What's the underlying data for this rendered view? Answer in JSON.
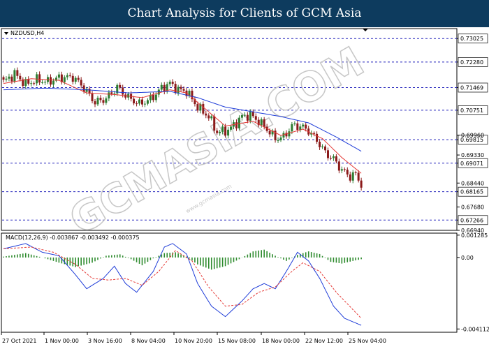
{
  "banner": {
    "title": "Chart Analysis for Clients of GCM Asia"
  },
  "chart_header": {
    "symbol_timeframe": "NZDUSD,H4"
  },
  "watermark": {
    "text": "GCMASIA.COM",
    "sub": "www.gcmasia.com"
  },
  "colors": {
    "banner": "#0d3b5e",
    "bull_candle": "#2e7d32",
    "bear_candle": "#8b1a1a",
    "ma_fast": "#e53935",
    "ma_slow": "#1e3cd8",
    "level_line": "#2222bb",
    "macd_line": "#1e3cd8",
    "signal_line": "#e53935",
    "histogram": "#2e8b2e"
  },
  "chart_data": [
    {
      "type": "candlestick",
      "title": "NZDUSD,H4",
      "ylim": [
        0.6694,
        0.7334
      ],
      "y_axis_labels": [
        "0.73025",
        "0.72280",
        "0.71469",
        "0.70751",
        "0.69815",
        "0.69071",
        "0.68165",
        "0.67266",
        "0.69960",
        "0.69330",
        "0.68440",
        "0.67680",
        "0.66940"
      ],
      "horizontal_levels": [
        0.73025,
        0.7228,
        0.71469,
        0.70751,
        0.69815,
        0.69071,
        0.68165,
        0.67266
      ],
      "plain_ticks": [
        0.6996,
        0.6933,
        0.6844,
        0.6768,
        0.6694
      ],
      "x_tick_labels": [
        "27 Oct 2021",
        "1 Nov 00:00",
        "3 Nov 16:00",
        "8 Nov 04:00",
        "10 Nov 20:00",
        "15 Nov 08:00",
        "18 Nov 00:00",
        "22 Nov 12:00",
        "25 Nov 04:00"
      ],
      "close_anchors": [
        [
          0,
          0.7165
        ],
        [
          4,
          0.719
        ],
        [
          8,
          0.7158
        ],
        [
          12,
          0.7172
        ],
        [
          16,
          0.7165
        ],
        [
          20,
          0.7178
        ],
        [
          25,
          0.718
        ],
        [
          28,
          0.7156
        ],
        [
          33,
          0.71
        ],
        [
          37,
          0.7112
        ],
        [
          41,
          0.7148
        ],
        [
          45,
          0.7115
        ],
        [
          49,
          0.7095
        ],
        [
          53,
          0.711
        ],
        [
          57,
          0.7145
        ],
        [
          60,
          0.716
        ],
        [
          63,
          0.714
        ],
        [
          66,
          0.7135
        ],
        [
          70,
          0.7085
        ],
        [
          74,
          0.7055
        ],
        [
          77,
          0.7005
        ],
        [
          81,
          0.7012
        ],
        [
          84,
          0.7035
        ],
        [
          86,
          0.7055
        ],
        [
          89,
          0.706
        ],
        [
          92,
          0.704
        ],
        [
          95,
          0.7015
        ],
        [
          98,
          0.6985
        ],
        [
          101,
          0.699
        ],
        [
          104,
          0.7025
        ],
        [
          107,
          0.7025
        ],
        [
          110,
          0.701
        ],
        [
          113,
          0.698
        ],
        [
          116,
          0.694
        ],
        [
          119,
          0.692
        ],
        [
          122,
          0.6885
        ],
        [
          125,
          0.6865
        ],
        [
          127,
          0.6872
        ],
        [
          129,
          0.684
        ]
      ],
      "series": [
        {
          "name": "MA fast",
          "anchors": [
            [
              0,
              0.716
            ],
            [
              10,
              0.7175
            ],
            [
              20,
              0.717
            ],
            [
              30,
              0.713
            ],
            [
              40,
              0.7125
            ],
            [
              50,
              0.7115
            ],
            [
              60,
              0.714
            ],
            [
              66,
              0.713
            ],
            [
              72,
              0.7085
            ],
            [
              80,
              0.7025
            ],
            [
              90,
              0.704
            ],
            [
              100,
              0.6995
            ],
            [
              108,
              0.7015
            ],
            [
              115,
              0.6985
            ],
            [
              122,
              0.6925
            ],
            [
              129,
              0.6875
            ]
          ]
        },
        {
          "name": "MA slow",
          "anchors": [
            [
              0,
              0.714
            ],
            [
              15,
              0.7145
            ],
            [
              30,
              0.714
            ],
            [
              45,
              0.713
            ],
            [
              60,
              0.7135
            ],
            [
              70,
              0.7115
            ],
            [
              80,
              0.7085
            ],
            [
              90,
              0.707
            ],
            [
              100,
              0.7055
            ],
            [
              110,
              0.7035
            ],
            [
              120,
              0.699
            ],
            [
              129,
              0.6945
            ]
          ]
        }
      ]
    },
    {
      "type": "line",
      "title": "MACD(12,26,9) -0.003867 -0.003492 -0.000375",
      "ylim": [
        -0.0043,
        0.0014
      ],
      "y_axis_labels": [
        "0.001285",
        "0.00",
        "-0.004112"
      ],
      "series": [
        {
          "name": "MACD",
          "anchors": [
            [
              0,
              0.0005
            ],
            [
              8,
              0.0008
            ],
            [
              14,
              0.0003
            ],
            [
              20,
              0.0001
            ],
            [
              26,
              -0.001
            ],
            [
              30,
              -0.0018
            ],
            [
              36,
              -0.0012
            ],
            [
              40,
              -0.0005
            ],
            [
              44,
              -0.0015
            ],
            [
              48,
              -0.002
            ],
            [
              54,
              -0.0008
            ],
            [
              58,
              0.0006
            ],
            [
              61,
              0.0008
            ],
            [
              66,
              0.0002
            ],
            [
              70,
              -0.0015
            ],
            [
              75,
              -0.0028
            ],
            [
              80,
              -0.0034
            ],
            [
              86,
              -0.0025
            ],
            [
              90,
              -0.0018
            ],
            [
              94,
              -0.0015
            ],
            [
              98,
              -0.0018
            ],
            [
              102,
              -0.0008
            ],
            [
              106,
              0.0003
            ],
            [
              110,
              -0.0002
            ],
            [
              114,
              -0.0012
            ],
            [
              119,
              -0.0028
            ],
            [
              123,
              -0.0035
            ],
            [
              129,
              -0.0039
            ]
          ]
        },
        {
          "name": "Signal",
          "anchors": [
            [
              0,
              0.0005
            ],
            [
              10,
              0.0006
            ],
            [
              18,
              0.0003
            ],
            [
              26,
              -0.0004
            ],
            [
              32,
              -0.0012
            ],
            [
              38,
              -0.0013
            ],
            [
              44,
              -0.0012
            ],
            [
              50,
              -0.0016
            ],
            [
              56,
              -0.0008
            ],
            [
              62,
              0.0004
            ],
            [
              68,
              -0.0002
            ],
            [
              74,
              -0.0017
            ],
            [
              80,
              -0.0028
            ],
            [
              86,
              -0.0027
            ],
            [
              92,
              -0.002
            ],
            [
              98,
              -0.0017
            ],
            [
              104,
              -0.0008
            ],
            [
              108,
              -0.0003
            ],
            [
              114,
              -0.0008
            ],
            [
              120,
              -0.002
            ],
            [
              126,
              -0.003
            ],
            [
              129,
              -0.0035
            ]
          ]
        },
        {
          "name": "Histogram",
          "anchors": [
            [
              0,
              5e-05
            ],
            [
              8,
              0.00025
            ],
            [
              14,
              0.0
            ],
            [
              20,
              -0.0003
            ],
            [
              26,
              -0.00055
            ],
            [
              32,
              -0.0003
            ],
            [
              37,
              0.0001
            ],
            [
              42,
              0.00018
            ],
            [
              46,
              -0.0001
            ],
            [
              50,
              -0.00045
            ],
            [
              54,
              -5e-05
            ],
            [
              58,
              0.00025
            ],
            [
              62,
              0.0003
            ],
            [
              66,
              5e-05
            ],
            [
              70,
              -0.0004
            ],
            [
              75,
              -0.0007
            ],
            [
              80,
              -0.0005
            ],
            [
              85,
              -0.0001
            ],
            [
              90,
              0.00035
            ],
            [
              94,
              0.00045
            ],
            [
              98,
              0.0001
            ],
            [
              102,
              -0.0002
            ],
            [
              106,
              0.00015
            ],
            [
              110,
              0.00035
            ],
            [
              114,
              0.0002
            ],
            [
              118,
              -0.00025
            ],
            [
              122,
              -0.00035
            ],
            [
              126,
              -0.0002
            ],
            [
              129,
              -0.0001
            ]
          ]
        }
      ],
      "x_tick_labels": [
        "27 Oct 2021",
        "1 Nov 00:00",
        "3 Nov 16:00",
        "8 Nov 04:00",
        "10 Nov 20:00",
        "15 Nov 08:00",
        "18 Nov 00:00",
        "22 Nov 12:00",
        "25 Nov 04:00"
      ]
    }
  ]
}
